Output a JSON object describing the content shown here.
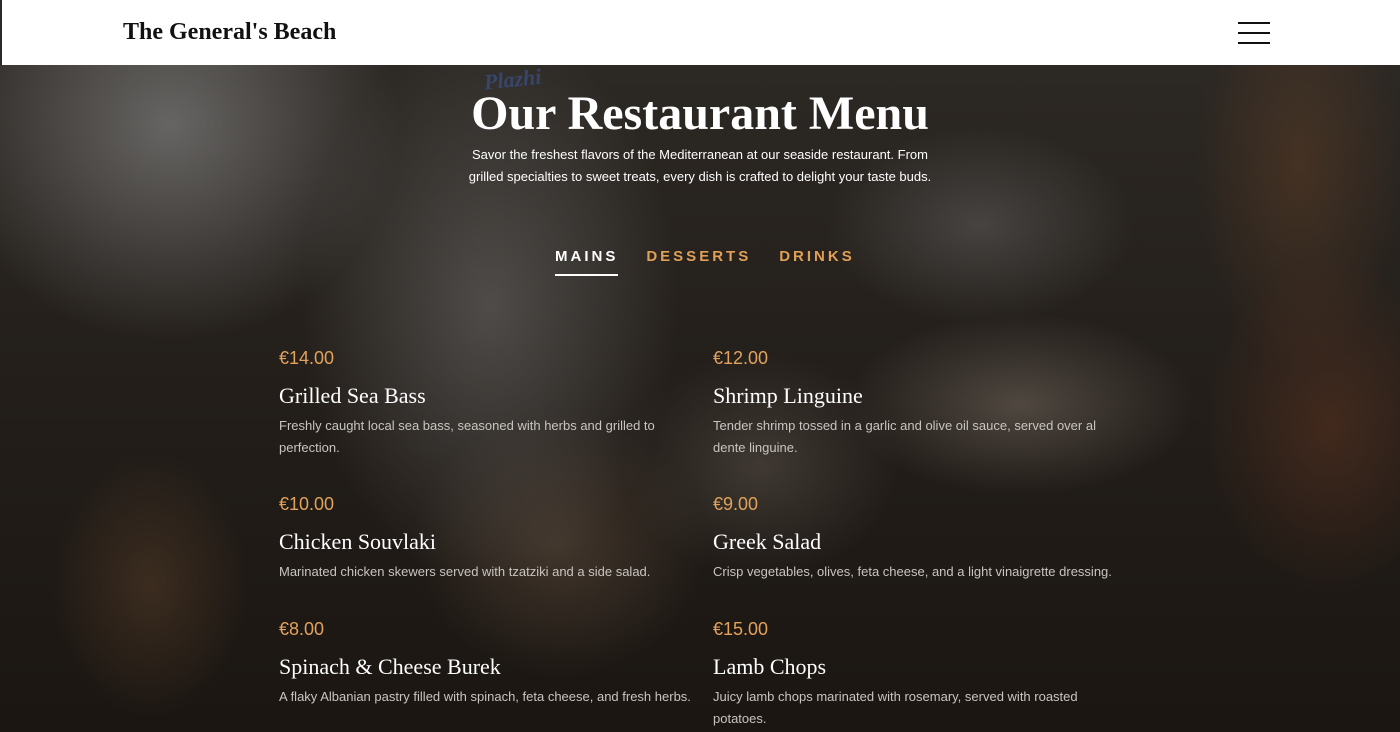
{
  "header": {
    "brand": "The General's Beach",
    "menu_icon": "hamburger-menu-icon"
  },
  "hero": {
    "logo_text": "Plazhi",
    "title": "Our Restaurant Menu",
    "subtitle": "Savor the freshest flavors of the Mediterranean at our seaside restaurant. From grilled specialties to sweet treats, every dish is crafted to delight your taste buds."
  },
  "tabs": [
    {
      "label": "MAINS",
      "active": true
    },
    {
      "label": "DESSERTS",
      "active": false
    },
    {
      "label": "DRINKS",
      "active": false
    }
  ],
  "menu_items": [
    {
      "price": "€14.00",
      "name": "Grilled Sea Bass",
      "description": "Freshly caught local sea bass, seasoned with herbs and grilled to perfection."
    },
    {
      "price": "€12.00",
      "name": "Shrimp Linguine",
      "description": "Tender shrimp tossed in a garlic and olive oil sauce, served over al dente linguine."
    },
    {
      "price": "€10.00",
      "name": "Chicken Souvlaki",
      "description": "Marinated chicken skewers served with tzatziki and a side salad."
    },
    {
      "price": "€9.00",
      "name": "Greek Salad",
      "description": "Crisp vegetables, olives, feta cheese, and a light vinaigrette dressing."
    },
    {
      "price": "€8.00",
      "name": "Spinach & Cheese Burek",
      "description": "A flaky Albanian pastry filled with spinach, feta cheese, and fresh herbs."
    },
    {
      "price": "€15.00",
      "name": "Lamb Chops",
      "description": "Juicy lamb chops marinated with rosemary, served with roasted potatoes."
    }
  ],
  "colors": {
    "accent": "#e2a25b",
    "tab_inactive": "#e0a055",
    "text_white": "#ffffff",
    "description": "#c8c4c0",
    "navbar_bg": "#ffffff"
  }
}
